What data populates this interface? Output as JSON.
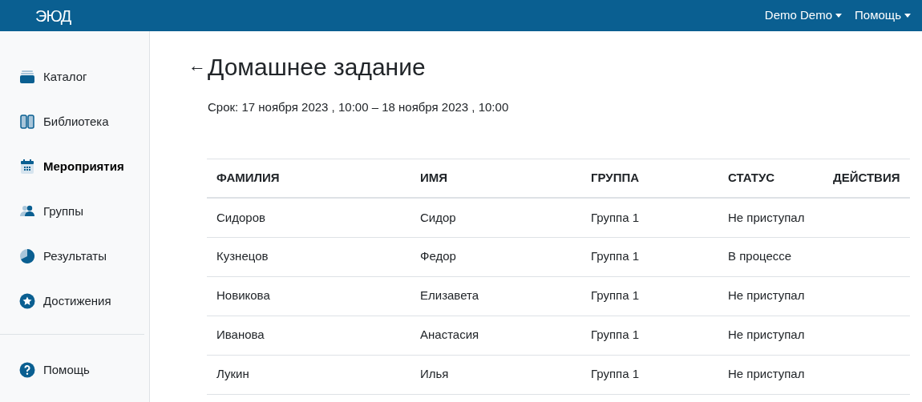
{
  "header": {
    "logo": "ЭЮД",
    "menus": [
      {
        "label": "Demo Demo"
      },
      {
        "label": "Помощь"
      }
    ]
  },
  "sidebar": {
    "items": [
      {
        "label": "Каталог",
        "selected": false
      },
      {
        "label": "Библиотека",
        "selected": false
      },
      {
        "label": "Мероприятия",
        "selected": true
      },
      {
        "label": "Группы",
        "selected": false
      },
      {
        "label": "Результаты",
        "selected": false
      },
      {
        "label": "Достижения",
        "selected": false
      }
    ],
    "footer_item": {
      "label": "Помощь"
    }
  },
  "page": {
    "back": "←",
    "title": "Домашнее задание",
    "deadline": "Срок: 17 ноября 2023 , 10:00 – 18 ноября 2023 , 10:00"
  },
  "table": {
    "columns": [
      "ФАМИЛИЯ",
      "ИМЯ",
      "ГРУППА",
      "СТАТУС",
      "ДЕЙСТВИЯ"
    ],
    "rows": [
      [
        "Сидоров",
        "Сидор",
        "Группа 1",
        "Не приступал"
      ],
      [
        "Кузнецов",
        "Федор",
        "Группа 1",
        "В процессе"
      ],
      [
        "Новикова",
        "Елизавета",
        "Группа 1",
        "Не приступал"
      ],
      [
        "Иванова",
        "Анастасия",
        "Группа 1",
        "Не приступал"
      ],
      [
        "Лукин",
        "Илья",
        "Группа 1",
        "Не приступал"
      ]
    ]
  }
}
